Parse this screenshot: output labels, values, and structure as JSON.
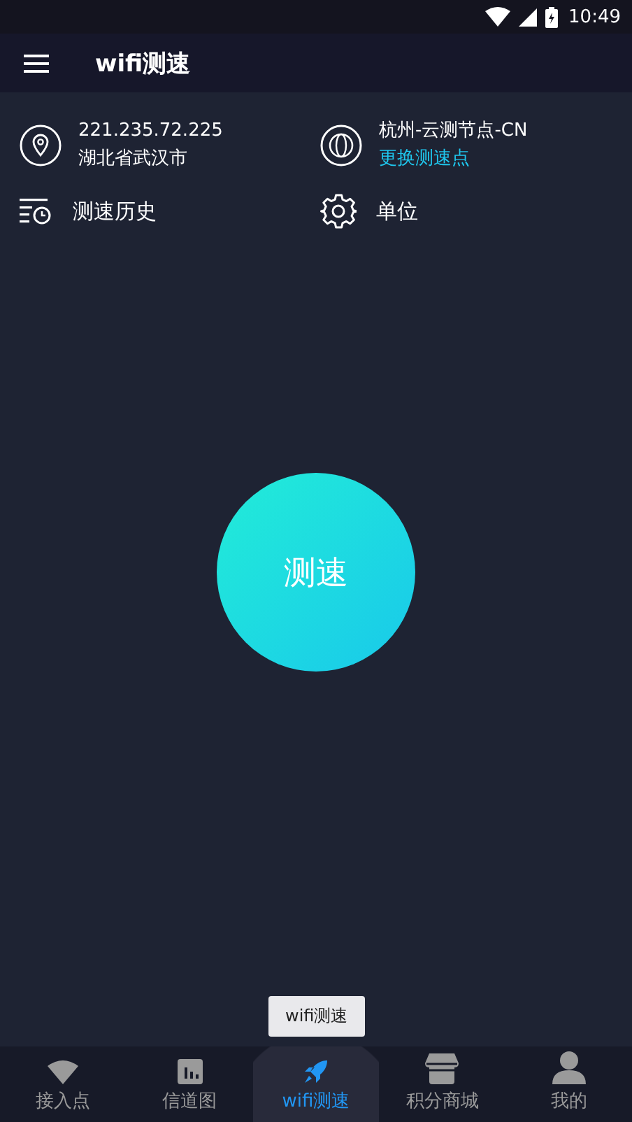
{
  "status_bar": {
    "time": "10:49"
  },
  "toolbar": {
    "title": "wifi测速"
  },
  "info": {
    "ip": "221.235.72.225",
    "location": "湖北省武汉市",
    "server": "杭州-云测节点-CN",
    "change_link": "更换测速点"
  },
  "actions": [
    {
      "label": "测速历史"
    },
    {
      "label": "单位"
    }
  ],
  "start_button": {
    "label": "测速"
  },
  "tooltip": {
    "text": "wifi测速"
  },
  "bottom_nav": [
    {
      "label": "接入点",
      "selected": false
    },
    {
      "label": "信道图",
      "selected": false
    },
    {
      "label": "wifi测速",
      "selected": true
    },
    {
      "label": "积分商城",
      "selected": false
    },
    {
      "label": "我的",
      "selected": false
    }
  ]
}
